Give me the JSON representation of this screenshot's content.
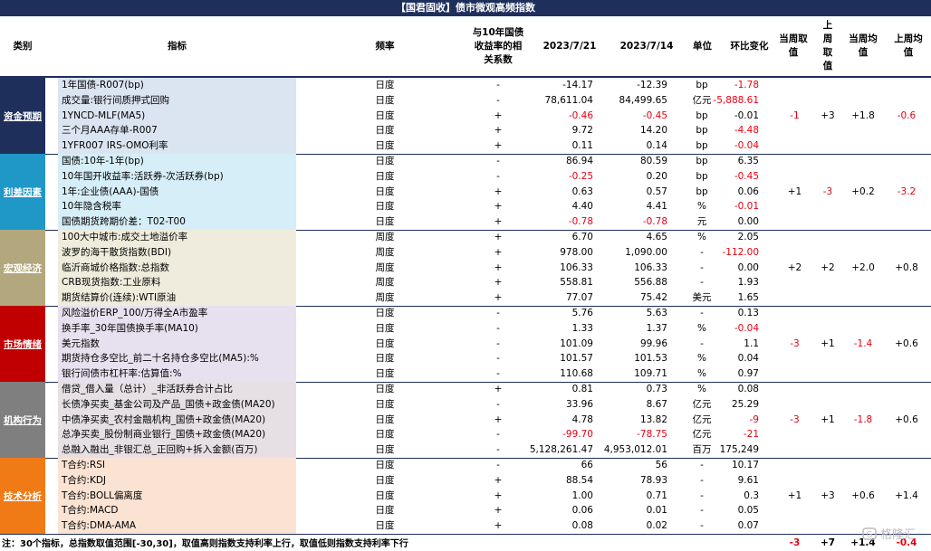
{
  "title": "【国君固收】债市微观高频指数",
  "headers": {
    "category": "类别",
    "indicator": "指标",
    "frequency": "频率",
    "relation": "与10年国债\n收益率的相\n关系数",
    "date1": "2023/7/21",
    "date2": "2023/7/14",
    "unit": "单位",
    "change": "环比变化",
    "this_week": "当周取\n值",
    "last_week": "上\n周\n取\n值",
    "this_avg": "当周均\n值",
    "last_avg": "上周均\n值"
  },
  "groups": [
    {
      "category": "资金预期",
      "cat_color": "#1f2f5c",
      "ind_color": "#dbe5f1",
      "summary": {
        "this_week": "-1",
        "last_week": "+3",
        "this_avg": "+1.8",
        "last_avg": "-0.6"
      },
      "summary_red": {
        "this_week": true,
        "last_week": false,
        "this_avg": false,
        "last_avg": true
      },
      "rows": [
        {
          "name": "1年国债-R007(bp)",
          "freq": "日度",
          "sign": "-",
          "v1": "-14.17",
          "v2": "-12.39",
          "unit": "bp",
          "chg": "-1.78",
          "v1_red": false,
          "v2_red": false,
          "chg_red": true
        },
        {
          "name": "成交量:银行间质押式回购",
          "freq": "日度",
          "sign": "-",
          "v1": "78,611.04",
          "v2": "84,499.65",
          "unit": "亿元",
          "chg": "-5,888.61",
          "v1_red": false,
          "v2_red": false,
          "chg_red": true
        },
        {
          "name": "1YNCD-MLF(MA5)",
          "freq": "日度",
          "sign": "+",
          "v1": "-0.46",
          "v2": "-0.45",
          "unit": "bp",
          "chg": "-0.01",
          "v1_red": true,
          "v2_red": true,
          "chg_red": false
        },
        {
          "name": "三个月AAA存单-R007",
          "freq": "日度",
          "sign": "+",
          "v1": "9.72",
          "v2": "14.20",
          "unit": "bp",
          "chg": "-4.48",
          "v1_red": false,
          "v2_red": false,
          "chg_red": true
        },
        {
          "name": "1YFR007 IRS-OMO利率",
          "freq": "日度",
          "sign": "+",
          "v1": "0.11",
          "v2": "0.14",
          "unit": "bp",
          "chg": "-0.04",
          "v1_red": false,
          "v2_red": false,
          "chg_red": true
        }
      ]
    },
    {
      "category": "利差因素",
      "cat_color": "#1f97c7",
      "ind_color": "#d6eef7",
      "summary": {
        "this_week": "+1",
        "last_week": "-3",
        "this_avg": "+0.2",
        "last_avg": "-3.2"
      },
      "summary_red": {
        "this_week": false,
        "last_week": true,
        "this_avg": false,
        "last_avg": true
      },
      "rows": [
        {
          "name": "国债:10年-1年(bp)",
          "freq": "日度",
          "sign": "-",
          "v1": "86.94",
          "v2": "80.59",
          "unit": "bp",
          "chg": "6.35",
          "v1_red": false,
          "v2_red": false,
          "chg_red": false
        },
        {
          "name": "10年国开收益率:活跃券-次活跃券(bp)",
          "freq": "日度",
          "sign": "-",
          "v1": "-0.25",
          "v2": "0.20",
          "unit": "bp",
          "chg": "-0.45",
          "v1_red": true,
          "v2_red": false,
          "chg_red": true
        },
        {
          "name": "1年:企业债(AAA)-国债",
          "freq": "日度",
          "sign": "+",
          "v1": "0.63",
          "v2": "0.57",
          "unit": "bp",
          "chg": "0.06",
          "v1_red": false,
          "v2_red": false,
          "chg_red": false
        },
        {
          "name": "10年隐含税率",
          "freq": "日度",
          "sign": "+",
          "v1": "4.40",
          "v2": "4.41",
          "unit": "%",
          "chg": "-0.01",
          "v1_red": false,
          "v2_red": false,
          "chg_red": true
        },
        {
          "name": "国债期货跨期价差：T02-T00",
          "freq": "日度",
          "sign": "+",
          "v1": "-0.78",
          "v2": "-0.78",
          "unit": "元",
          "chg": "0.00",
          "v1_red": true,
          "v2_red": true,
          "chg_red": false
        }
      ]
    },
    {
      "category": "宏观经济",
      "cat_color": "#b3a77e",
      "ind_color": "#f0ecdd",
      "summary": {
        "this_week": "+2",
        "last_week": "+2",
        "this_avg": "+2.0",
        "last_avg": "+0.8"
      },
      "summary_red": {
        "this_week": false,
        "last_week": false,
        "this_avg": false,
        "last_avg": false
      },
      "rows": [
        {
          "name": "100大中城市:成交土地溢价率",
          "freq": "周度",
          "sign": "+",
          "v1": "6.70",
          "v2": "4.65",
          "unit": "%",
          "chg": "2.05",
          "v1_red": false,
          "v2_red": false,
          "chg_red": false
        },
        {
          "name": "波罗的海干散货指数(BDI)",
          "freq": "周度",
          "sign": "+",
          "v1": "978.00",
          "v2": "1,090.00",
          "unit": "-",
          "chg": "-112.00",
          "v1_red": false,
          "v2_red": false,
          "chg_red": true
        },
        {
          "name": "临沂商城价格指数:总指数",
          "freq": "周度",
          "sign": "+",
          "v1": "106.33",
          "v2": "106.33",
          "unit": "-",
          "chg": "0.00",
          "v1_red": false,
          "v2_red": false,
          "chg_red": false
        },
        {
          "name": "CRB现货指数:工业原料",
          "freq": "周度",
          "sign": "+",
          "v1": "558.81",
          "v2": "556.88",
          "unit": "-",
          "chg": "1.93",
          "v1_red": false,
          "v2_red": false,
          "chg_red": false
        },
        {
          "name": "期货结算价(连续):WTI原油",
          "freq": "周度",
          "sign": "+",
          "v1": "77.07",
          "v2": "75.42",
          "unit": "美元",
          "chg": "1.65",
          "v1_red": false,
          "v2_red": false,
          "chg_red": false
        }
      ]
    },
    {
      "category": "市场情绪",
      "cat_color": "#c00000",
      "ind_color": "#e7e0ee",
      "summary": {
        "this_week": "-3",
        "last_week": "+1",
        "this_avg": "-1.4",
        "last_avg": "+0.6"
      },
      "summary_red": {
        "this_week": true,
        "last_week": false,
        "this_avg": true,
        "last_avg": false
      },
      "rows": [
        {
          "name": "风险溢价ERP_100/万得全A市盈率",
          "freq": "日度",
          "sign": "-",
          "v1": "5.76",
          "v2": "5.63",
          "unit": "-",
          "chg": "0.13",
          "v1_red": false,
          "v2_red": false,
          "chg_red": false
        },
        {
          "name": "换手率_30年国债换手率(MA10)",
          "freq": "日度",
          "sign": "-",
          "v1": "1.33",
          "v2": "1.37",
          "unit": "%",
          "chg": "-0.04",
          "v1_red": false,
          "v2_red": false,
          "chg_red": true
        },
        {
          "name": "美元指数",
          "freq": "日度",
          "sign": "-",
          "v1": "101.09",
          "v2": "99.96",
          "unit": "-",
          "chg": "1.1",
          "v1_red": false,
          "v2_red": false,
          "chg_red": false
        },
        {
          "name": "期货持仓多空比_前二十名持仓多空比(MA5):%",
          "freq": "日度",
          "sign": "-",
          "v1": "101.57",
          "v2": "101.53",
          "unit": "%",
          "chg": "0.04",
          "v1_red": false,
          "v2_red": false,
          "chg_red": false
        },
        {
          "name": "银行间债市杠杆率:估算值:%",
          "freq": "日度",
          "sign": "-",
          "v1": "110.68",
          "v2": "109.71",
          "unit": "%",
          "chg": "0.97",
          "v1_red": false,
          "v2_red": false,
          "chg_red": false
        }
      ]
    },
    {
      "category": "机构行为",
      "cat_color": "#7f7f7f",
      "ind_color": "#e6dfe4",
      "summary": {
        "this_week": "-3",
        "last_week": "+1",
        "this_avg": "-1.8",
        "last_avg": "+0.6"
      },
      "summary_red": {
        "this_week": true,
        "last_week": false,
        "this_avg": true,
        "last_avg": false
      },
      "rows": [
        {
          "name": "借贷_借入量（总计）_非活跃券合计占比",
          "freq": "日度",
          "sign": "+",
          "v1": "0.81",
          "v2": "0.73",
          "unit": "%",
          "chg": "0.08",
          "v1_red": false,
          "v2_red": false,
          "chg_red": false
        },
        {
          "name": "长债净买卖_基金公司及产品_国债+政金债(MA20)",
          "freq": "日度",
          "sign": "-",
          "v1": "33.96",
          "v2": "8.67",
          "unit": "亿元",
          "chg": "25.29",
          "v1_red": false,
          "v2_red": false,
          "chg_red": false
        },
        {
          "name": "中债净买卖_农村金融机构_国债+政金债(MA20)",
          "freq": "日度",
          "sign": "+",
          "v1": "4.78",
          "v2": "13.82",
          "unit": "亿元",
          "chg": "-9",
          "v1_red": false,
          "v2_red": false,
          "chg_red": true
        },
        {
          "name": "总净买卖_股份制商业银行_国债+政金债(MA20)",
          "freq": "日度",
          "sign": "-",
          "v1": "-99.70",
          "v2": "-78.75",
          "unit": "亿元",
          "chg": "-21",
          "v1_red": true,
          "v2_red": true,
          "chg_red": true
        },
        {
          "name": "总融入融出_非银汇总_正回购+拆入金额(百万)",
          "freq": "日度",
          "sign": "-",
          "v1": "5,128,261.47",
          "v2": "4,953,012.01",
          "unit": "百万",
          "chg": "175,249",
          "v1_red": false,
          "v2_red": false,
          "chg_red": false
        }
      ]
    },
    {
      "category": "技术分析",
      "cat_color": "#f07b16",
      "ind_color": "#fbe3d3",
      "summary": {
        "this_week": "+1",
        "last_week": "+3",
        "this_avg": "+0.6",
        "last_avg": "+1.4"
      },
      "summary_red": {
        "this_week": false,
        "last_week": false,
        "this_avg": false,
        "last_avg": false
      },
      "rows": [
        {
          "name": "T合约:RSI",
          "freq": "日度",
          "sign": "-",
          "v1": "66",
          "v2": "56",
          "unit": "-",
          "chg": "10.17",
          "v1_red": false,
          "v2_red": false,
          "chg_red": false
        },
        {
          "name": "T合约:KDJ",
          "freq": "日度",
          "sign": "+",
          "v1": "88.54",
          "v2": "78.93",
          "unit": "-",
          "chg": "9.61",
          "v1_red": false,
          "v2_red": false,
          "chg_red": false
        },
        {
          "name": "T合约:BOLL偏离度",
          "freq": "日度",
          "sign": "+",
          "v1": "1.00",
          "v2": "0.71",
          "unit": "-",
          "chg": "0.3",
          "v1_red": false,
          "v2_red": false,
          "chg_red": false
        },
        {
          "name": "T合约:MACD",
          "freq": "日度",
          "sign": "+",
          "v1": "0.06",
          "v2": "0.01",
          "unit": "-",
          "chg": "0.05",
          "v1_red": false,
          "v2_red": false,
          "chg_red": false
        },
        {
          "name": "T合约:DMA-AMA",
          "freq": "日度",
          "sign": "+",
          "v1": "0.08",
          "v2": "0.02",
          "unit": "-",
          "chg": "0.07",
          "v1_red": false,
          "v2_red": false,
          "chg_red": false
        }
      ]
    }
  ],
  "total": {
    "this_week": "-3",
    "last_week": "+7",
    "this_avg": "+1.4",
    "last_avg": "-0.4"
  },
  "total_red": {
    "this_week": true,
    "last_week": false,
    "this_avg": false,
    "last_avg": true
  },
  "note": "注：30个指标，总指数取值范围[-30,30]，取值高则指数支持利率上行，取值低则指数支持利率下行",
  "watermark": "格隆汇"
}
